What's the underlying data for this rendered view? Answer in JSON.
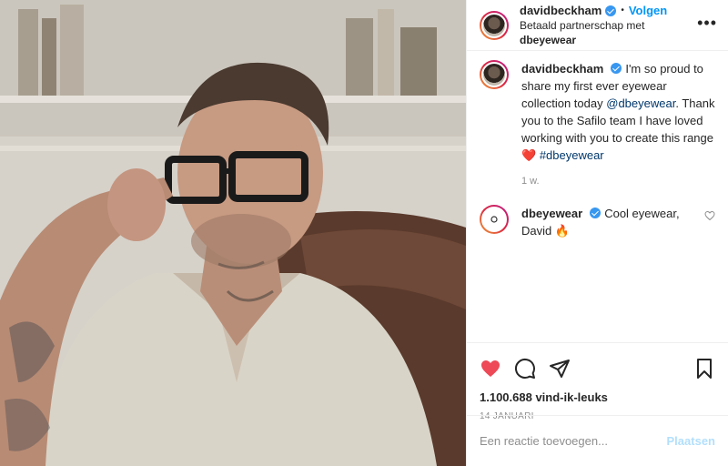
{
  "header": {
    "username": "davidbeckham",
    "dot": "•",
    "follow_label": "Volgen",
    "partnership_prefix": "Betaald partnerschap met",
    "partner": "dbeyewear",
    "more_icon": "more-horizontal-icon"
  },
  "caption": {
    "username": "davidbeckham",
    "text_part1": "I'm so proud to share my first ever eyewear collection today",
    "mention": "@dbeyewear",
    "text_part2": ". Thank you to the Safilo team I have loved working with you to create this range",
    "emoji": "❤️",
    "hashtag": "#dbeyewear",
    "time": "1 w."
  },
  "comments": [
    {
      "username": "dbeyewear",
      "text": "Cool eyewear, David",
      "emoji": "🔥"
    }
  ],
  "actions": {
    "like_icon": "heart-filled-icon",
    "comment_icon": "comment-icon",
    "share_icon": "paper-plane-icon",
    "save_icon": "bookmark-icon",
    "likes": "1.100.688 vind-ik-leuks",
    "date": "14 JANUARI"
  },
  "add_comment": {
    "placeholder": "Een reactie toevoegen...",
    "post_label": "Plaatsen"
  },
  "colors": {
    "accent": "#0095f6",
    "like": "#ed4956",
    "verified": "#3897f0",
    "link": "#00376b"
  }
}
